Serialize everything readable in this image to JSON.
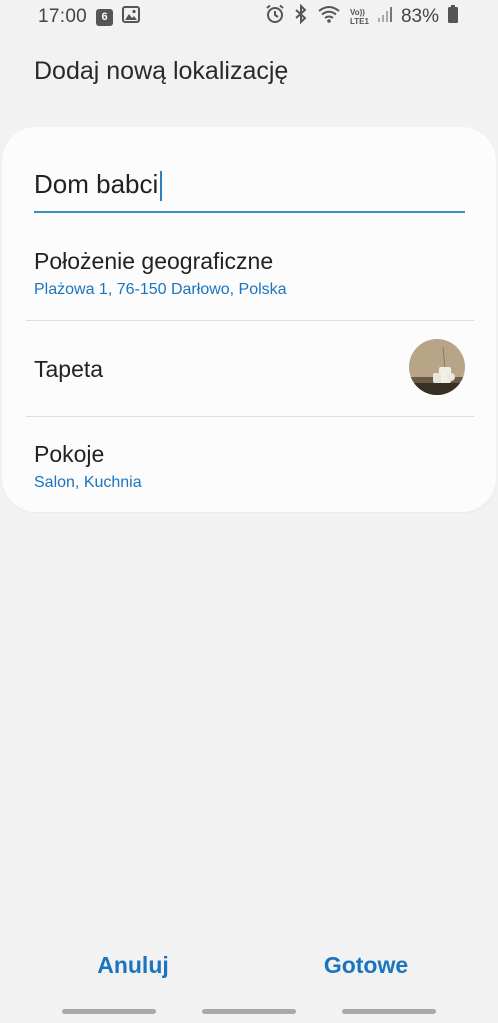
{
  "status_bar": {
    "time": "17:00",
    "notification_count": "6",
    "network_label_top": "Vo))",
    "network_label_bottom": "LTE1",
    "battery_percent": "83%"
  },
  "page": {
    "title": "Dodaj nową lokalizację"
  },
  "form": {
    "name_value": "Dom babci",
    "location": {
      "label": "Położenie geograficzne",
      "value": "Plażowa 1, 76-150 Darłowo, Polska"
    },
    "wallpaper": {
      "label": "Tapeta"
    },
    "rooms": {
      "label": "Pokoje",
      "value": "Salon, Kuchnia"
    }
  },
  "actions": {
    "cancel_label": "Anuluj",
    "done_label": "Gotowe"
  },
  "colors": {
    "accent": "#1a74c0",
    "background": "#f2f2f2",
    "card": "#fcfcfc"
  },
  "icons": [
    "notification-badge-icon",
    "gallery-icon",
    "alarm-icon",
    "bluetooth-icon",
    "wifi-icon",
    "signal-icon",
    "battery-icon"
  ]
}
